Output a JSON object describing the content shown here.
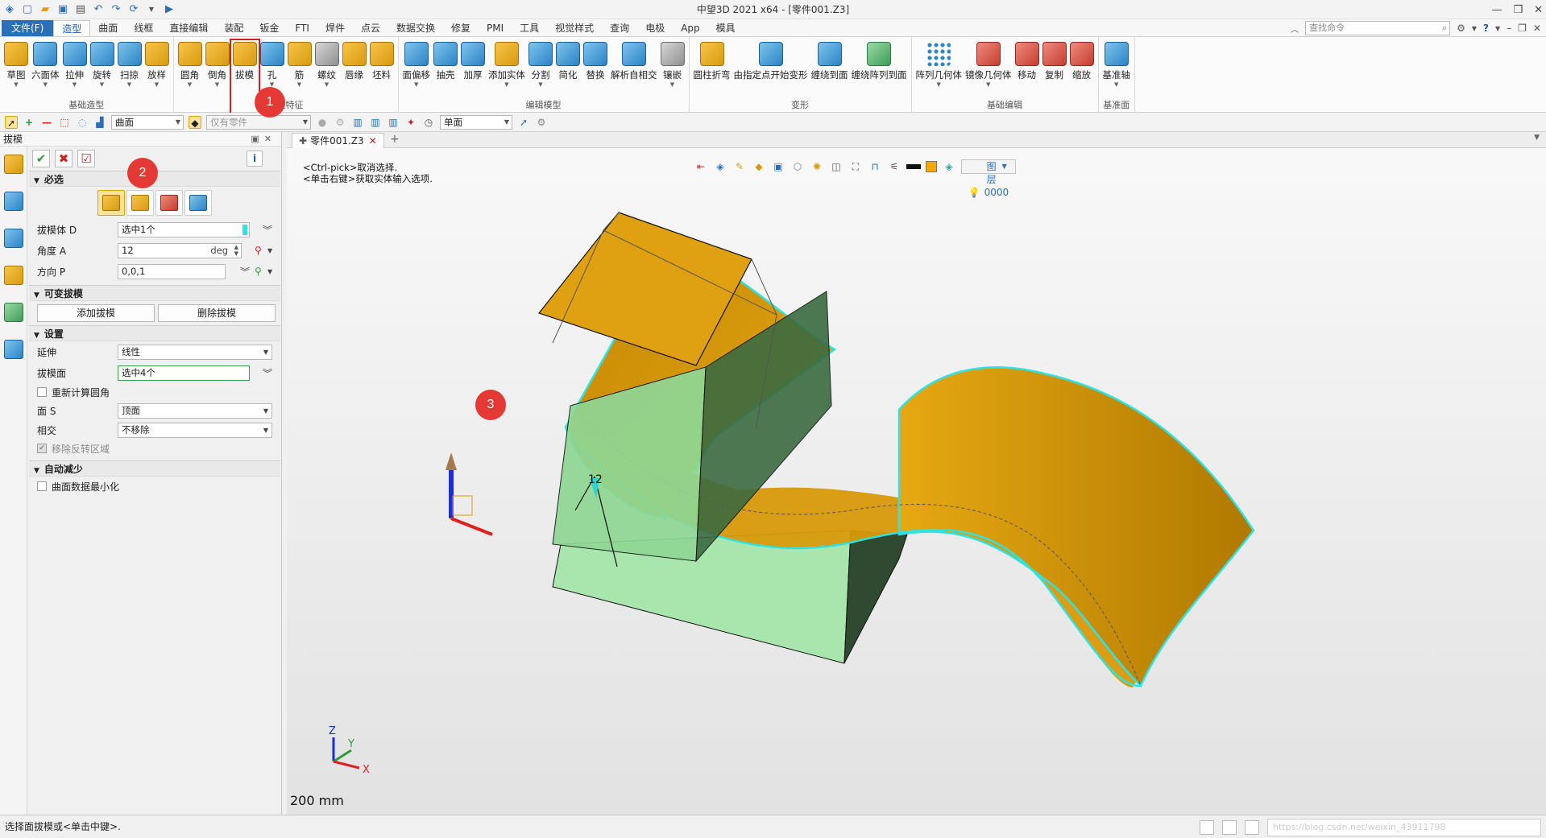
{
  "window": {
    "title": "中望3D 2021 x64 - [零件001.Z3]",
    "controls": [
      "—",
      "❐",
      "✕"
    ]
  },
  "menu": {
    "file": "文件(F)",
    "tabs": [
      "造型",
      "曲面",
      "线框",
      "直接编辑",
      "装配",
      "钣金",
      "FTI",
      "焊件",
      "点云",
      "数据交换",
      "修复",
      "PMI",
      "工具",
      "视觉样式",
      "查询",
      "电极",
      "App",
      "模具"
    ],
    "active_tab": "造型",
    "search_placeholder": "查找命令"
  },
  "ribbon": {
    "groups": [
      {
        "label": "基础造型",
        "buttons": [
          {
            "label": "草图",
            "icon": "sketch-icon",
            "color": "o",
            "arrow": true
          },
          {
            "label": "六面体",
            "icon": "box-icon",
            "color": "b",
            "arrow": true
          },
          {
            "label": "拉伸",
            "icon": "extrude-icon",
            "color": "b",
            "arrow": true
          },
          {
            "label": "旋转",
            "icon": "revolve-icon",
            "color": "b",
            "arrow": true
          },
          {
            "label": "扫掠",
            "icon": "sweep-icon",
            "color": "b",
            "arrow": true
          },
          {
            "label": "放样",
            "icon": "loft-icon",
            "color": "o",
            "arrow": true
          }
        ]
      },
      {
        "label": "工程特征",
        "buttons": [
          {
            "label": "圆角",
            "icon": "fillet-icon",
            "color": "o",
            "arrow": true
          },
          {
            "label": "倒角",
            "icon": "chamfer-icon",
            "color": "o",
            "arrow": true
          },
          {
            "label": "拔模",
            "icon": "draft-icon",
            "color": "o",
            "arrow": false,
            "highlight": true
          },
          {
            "label": "孔",
            "icon": "hole-icon",
            "color": "b",
            "arrow": true
          },
          {
            "label": "筋",
            "icon": "rib-icon",
            "color": "o",
            "arrow": true
          },
          {
            "label": "螺纹",
            "icon": "thread-icon",
            "color": "gr",
            "arrow": true
          },
          {
            "label": "唇缘",
            "icon": "lip-icon",
            "color": "o",
            "arrow": false
          },
          {
            "label": "坯料",
            "icon": "stock-icon",
            "color": "o",
            "arrow": false
          }
        ]
      },
      {
        "label": "编辑模型",
        "buttons": [
          {
            "label": "面偏移",
            "icon": "face-offset-icon",
            "color": "b",
            "arrow": true
          },
          {
            "label": "抽壳",
            "icon": "shell-icon",
            "color": "b",
            "arrow": false
          },
          {
            "label": "加厚",
            "icon": "thicken-icon",
            "color": "b",
            "arrow": false
          },
          {
            "label": "添加实体",
            "icon": "add-solid-icon",
            "color": "o",
            "arrow": true
          },
          {
            "label": "分割",
            "icon": "split-icon",
            "color": "b",
            "arrow": true
          },
          {
            "label": "简化",
            "icon": "simplify-icon",
            "color": "b",
            "arrow": false
          },
          {
            "label": "替换",
            "icon": "replace-icon",
            "color": "b",
            "arrow": false
          },
          {
            "label": "解析自相交",
            "icon": "self-intersect-icon",
            "color": "b",
            "arrow": false
          },
          {
            "label": "镶嵌",
            "icon": "emboss-icon",
            "color": "gr",
            "arrow": true
          }
        ]
      },
      {
        "label": "变形",
        "buttons": [
          {
            "label": "圆柱折弯",
            "icon": "cylinder-bend-icon",
            "color": "o",
            "arrow": false
          },
          {
            "label": "由指定点开始变形",
            "icon": "point-deform-icon",
            "color": "b",
            "arrow": false
          },
          {
            "label": "缠绕到面",
            "icon": "wrap-face-icon",
            "color": "b",
            "arrow": false
          },
          {
            "label": "缠绕阵列到面",
            "icon": "wrap-pattern-icon",
            "color": "g",
            "arrow": false
          }
        ]
      },
      {
        "label": "基础编辑",
        "buttons": [
          {
            "label": "阵列几何体",
            "icon": "pattern-icon",
            "color": "dots",
            "arrow": true
          },
          {
            "label": "镜像几何体",
            "icon": "mirror-icon",
            "color": "r",
            "arrow": true
          },
          {
            "label": "移动",
            "icon": "move-icon",
            "color": "r",
            "arrow": false
          },
          {
            "label": "复制",
            "icon": "copy-icon",
            "color": "r",
            "arrow": false
          },
          {
            "label": "缩放",
            "icon": "scale-icon",
            "color": "r",
            "arrow": false
          }
        ]
      },
      {
        "label": "基准面",
        "buttons": [
          {
            "label": "基准轴",
            "icon": "datum-axis-icon",
            "color": "b",
            "arrow": true
          }
        ]
      }
    ]
  },
  "toolbar2": {
    "filter": "曲面",
    "scope": "仅有零件",
    "pick_mode": "单面"
  },
  "panel": {
    "title": "拔模",
    "required_section": "必选",
    "draft_body_label": "拔模体 D",
    "draft_body_value": "选中1个",
    "angle_label": "角度 A",
    "angle_value": "12",
    "angle_unit": "deg",
    "direction_label": "方向 P",
    "direction_value": "0,0,1",
    "variable_section": "可变拔模",
    "add_draft": "添加拔模",
    "delete_draft": "删除拔模",
    "settings_section": "设置",
    "extend_label": "延伸",
    "extend_value": "线性",
    "draft_face_label": "拔模面",
    "draft_face_value": "选中4个",
    "recalc_fillet": "重新计算圆角",
    "face_s_label": "面 S",
    "face_s_value": "顶面",
    "intersect_label": "相交",
    "intersect_value": "不移除",
    "remove_flip": "移除反转区域",
    "auto_reduce_section": "自动减少",
    "surface_min": "曲面数据最小化"
  },
  "viewport": {
    "doc_tab": "零件001.Z3",
    "hint_line1": "<Ctrl-pick>取消选择.",
    "hint_line2": "<单击右键>获取实体输入选项.",
    "layer": "图层0000",
    "scale": "200 mm",
    "angle_tag": "12",
    "axis_x": "X",
    "axis_y": "Y",
    "axis_z": "Z"
  },
  "markers": [
    "1",
    "2",
    "3"
  ],
  "status": {
    "text": "选择面拔模或<单击中键>.",
    "watermark": "https://blog.csdn.net/weixin_43911798"
  },
  "colors": {
    "orange_surface": "#d89a0a",
    "green_face": "#8fd694",
    "highlight_cyan": "#2fe3e3",
    "file_tab": "#2b6fb8",
    "marker_red": "#e53935"
  }
}
